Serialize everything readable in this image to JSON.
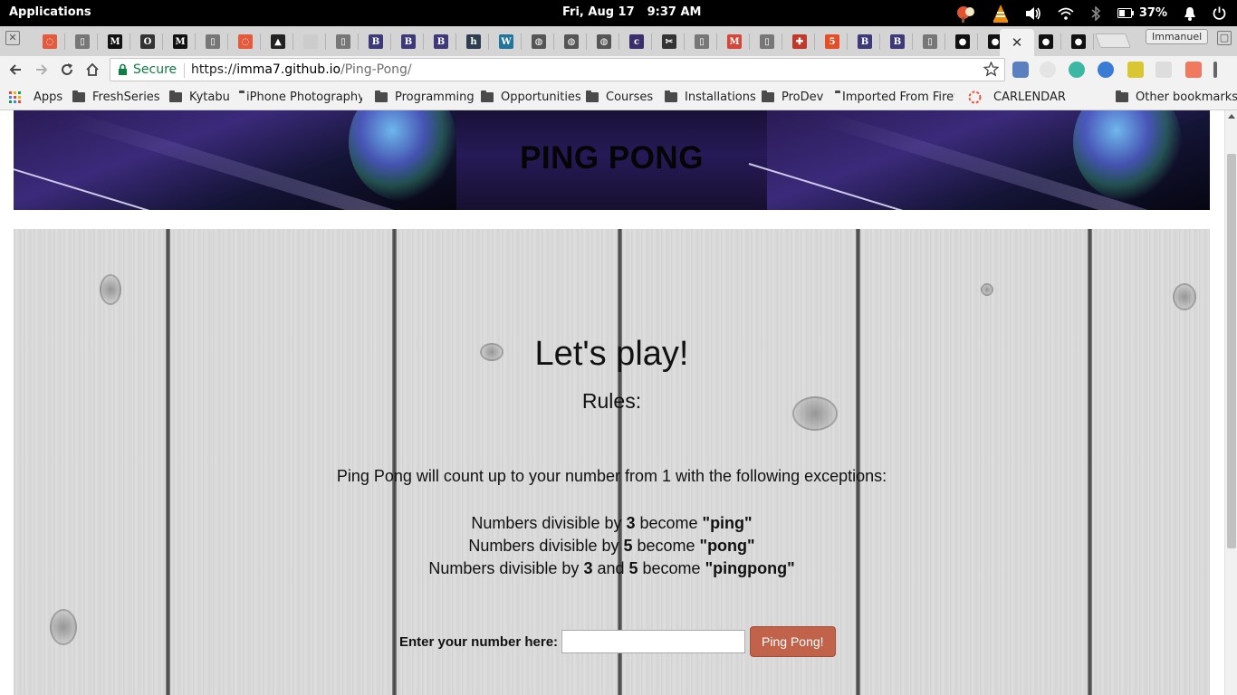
{
  "os": {
    "apps_label": "Applications",
    "date": "Fri, Aug 17",
    "time": "9:37 AM",
    "battery": "37%"
  },
  "tabs": {
    "active_close": "✕",
    "profile": "Immanuel",
    "favicons": [
      {
        "name": "circle-logo-icon",
        "color": "#e35a3c",
        "glyph": "◌"
      },
      {
        "name": "page-icon",
        "color": "#777777",
        "glyph": "▯"
      },
      {
        "name": "medium-icon",
        "color": "#111111",
        "glyph": "M"
      },
      {
        "name": "circle-icon",
        "color": "#333333",
        "glyph": "O"
      },
      {
        "name": "medium-icon",
        "color": "#111111",
        "glyph": "M"
      },
      {
        "name": "page-icon",
        "color": "#777777",
        "glyph": "▯"
      },
      {
        "name": "circle-logo-icon",
        "color": "#e35a3c",
        "glyph": "◌"
      },
      {
        "name": "triangle-icon",
        "color": "#222222",
        "glyph": "▲"
      },
      {
        "name": "blank-icon",
        "color": "#cccccc",
        "glyph": ""
      },
      {
        "name": "page-icon",
        "color": "#777777",
        "glyph": "▯"
      },
      {
        "name": "bootstrap-icon",
        "color": "#3e3a7a",
        "glyph": "B"
      },
      {
        "name": "bootstrap-icon",
        "color": "#3e3a7a",
        "glyph": "B"
      },
      {
        "name": "bootstrap-icon",
        "color": "#3e3a7a",
        "glyph": "B"
      },
      {
        "name": "h-icon",
        "color": "#2c3e50",
        "glyph": "h"
      },
      {
        "name": "wordpress-icon",
        "color": "#21759b",
        "glyph": "W"
      },
      {
        "name": "globe-icon",
        "color": "#555555",
        "glyph": "◍"
      },
      {
        "name": "globe-icon",
        "color": "#555555",
        "glyph": "◍"
      },
      {
        "name": "globe-icon",
        "color": "#555555",
        "glyph": "◍"
      },
      {
        "name": "colorlib-icon",
        "color": "#3a2f6b",
        "glyph": "c"
      },
      {
        "name": "tool-icon",
        "color": "#333333",
        "glyph": "✂"
      },
      {
        "name": "page-icon",
        "color": "#777777",
        "glyph": "▯"
      },
      {
        "name": "gmail-icon",
        "color": "#d44638",
        "glyph": "M"
      },
      {
        "name": "page-icon",
        "color": "#777777",
        "glyph": "▯"
      },
      {
        "name": "plus-icon",
        "color": "#c0392b",
        "glyph": "✚"
      },
      {
        "name": "html-icon",
        "color": "#e44d26",
        "glyph": "5"
      },
      {
        "name": "bootstrap-icon",
        "color": "#3e3a7a",
        "glyph": "B"
      },
      {
        "name": "bootstrap-icon",
        "color": "#3e3a7a",
        "glyph": "B"
      },
      {
        "name": "page-icon",
        "color": "#777777",
        "glyph": "▯"
      },
      {
        "name": "github-icon",
        "color": "#111111",
        "glyph": "●"
      },
      {
        "name": "github-icon",
        "color": "#111111",
        "glyph": "●"
      }
    ],
    "after_active": [
      {
        "name": "github-icon",
        "color": "#111111",
        "glyph": "●"
      },
      {
        "name": "github-icon",
        "color": "#111111",
        "glyph": "●"
      }
    ]
  },
  "toolbar": {
    "secure_label": "Secure",
    "url_scheme": "https://",
    "url_host": "imma7.github.io",
    "url_path": "/Ping-Pong/"
  },
  "bookmarks": {
    "apps": "Apps",
    "items": [
      "FreshSeries",
      "Kytabu",
      "iPhone Photography",
      "Programming",
      "Opportunities",
      "Courses",
      "Installations",
      "ProDev",
      "Imported From Firefox"
    ],
    "carlendar": "CARLENDAR",
    "other": "Other bookmarks"
  },
  "page": {
    "banner_title": "PING PONG",
    "heading": "Let's play!",
    "subheading": "Rules:",
    "intro": "Ping Pong will count up to your number from 1 with the following exceptions:",
    "rules": [
      {
        "pre": "Numbers divisible by ",
        "n1": "3",
        "mid": "",
        "n2": "",
        "verb": " become ",
        "word": "\"ping\""
      },
      {
        "pre": "Numbers divisible by ",
        "n1": "5",
        "mid": "",
        "n2": "",
        "verb": " become ",
        "word": "\"pong\""
      },
      {
        "pre": "Numbers divisible by ",
        "n1": "3",
        "mid": " and ",
        "n2": "5",
        "verb": " become ",
        "word": "\"pingpong\""
      }
    ],
    "input_label": "Enter your number here:",
    "input_value": "",
    "button_label": "Ping Pong!"
  },
  "colors": {
    "secure_green": "#0b8043",
    "button": "#c0634a",
    "banner": "#261a57"
  }
}
